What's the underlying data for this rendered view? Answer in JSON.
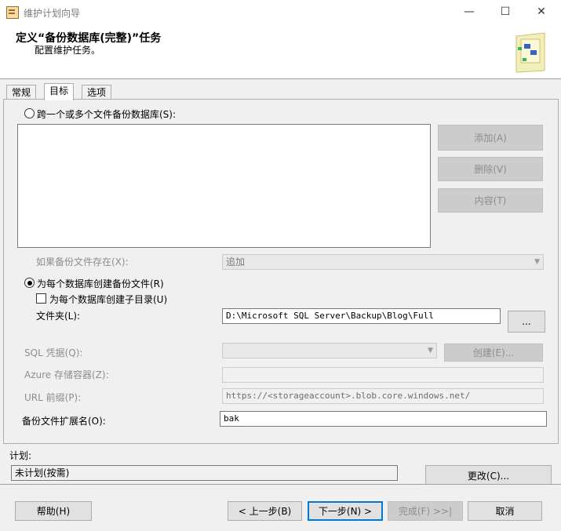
{
  "window": {
    "title": "维护计划向导",
    "minimize_glyph": "—",
    "maximize_glyph": "☐",
    "close_glyph": "✕"
  },
  "header": {
    "title": "定义“备份数据库(完整)”任务",
    "subtitle": "配置维护任务。"
  },
  "tabs": [
    {
      "label": "常规",
      "active": false
    },
    {
      "label": "目标",
      "active": true
    },
    {
      "label": "选项",
      "active": false
    }
  ],
  "target": {
    "span_files_label": "跨一个或多个文件备份数据库(S):",
    "add_button": "添加(A)",
    "remove_button": "删除(V)",
    "contents_button": "内容(T)",
    "if_exists_label": "如果备份文件存在(X):",
    "if_exists_value": "追加",
    "per_db_label": "为每个数据库创建备份文件(R)",
    "subdir_label": "为每个数据库创建子目录(U)",
    "folder_label": "文件夹(L):",
    "folder_value": "D:\\Microsoft SQL Server\\Backup\\Blog\\Full",
    "browse_button": "...",
    "sql_credential_label": "SQL 凭据(Q):",
    "create_button": "创建(E)...",
    "azure_container_label": "Azure 存储容器(Z):",
    "url_prefix_label": "URL 前缀(P):",
    "url_prefix_value": "https://<storageaccount>.blob.core.windows.net/",
    "extension_label": "备份文件扩展名(O):",
    "extension_value": "bak"
  },
  "schedule": {
    "label": "计划:",
    "value": "未计划(按需)",
    "change_button": "更改(C)..."
  },
  "footer": {
    "help_button": "帮助(H)",
    "back_button": "< 上一步(B)",
    "next_button": "下一步(N) >",
    "finish_button": "完成(F) >>|",
    "cancel_button": "取消"
  },
  "colors": {
    "accent": "#0078d7",
    "disabled_text": "#8d8d8d"
  }
}
